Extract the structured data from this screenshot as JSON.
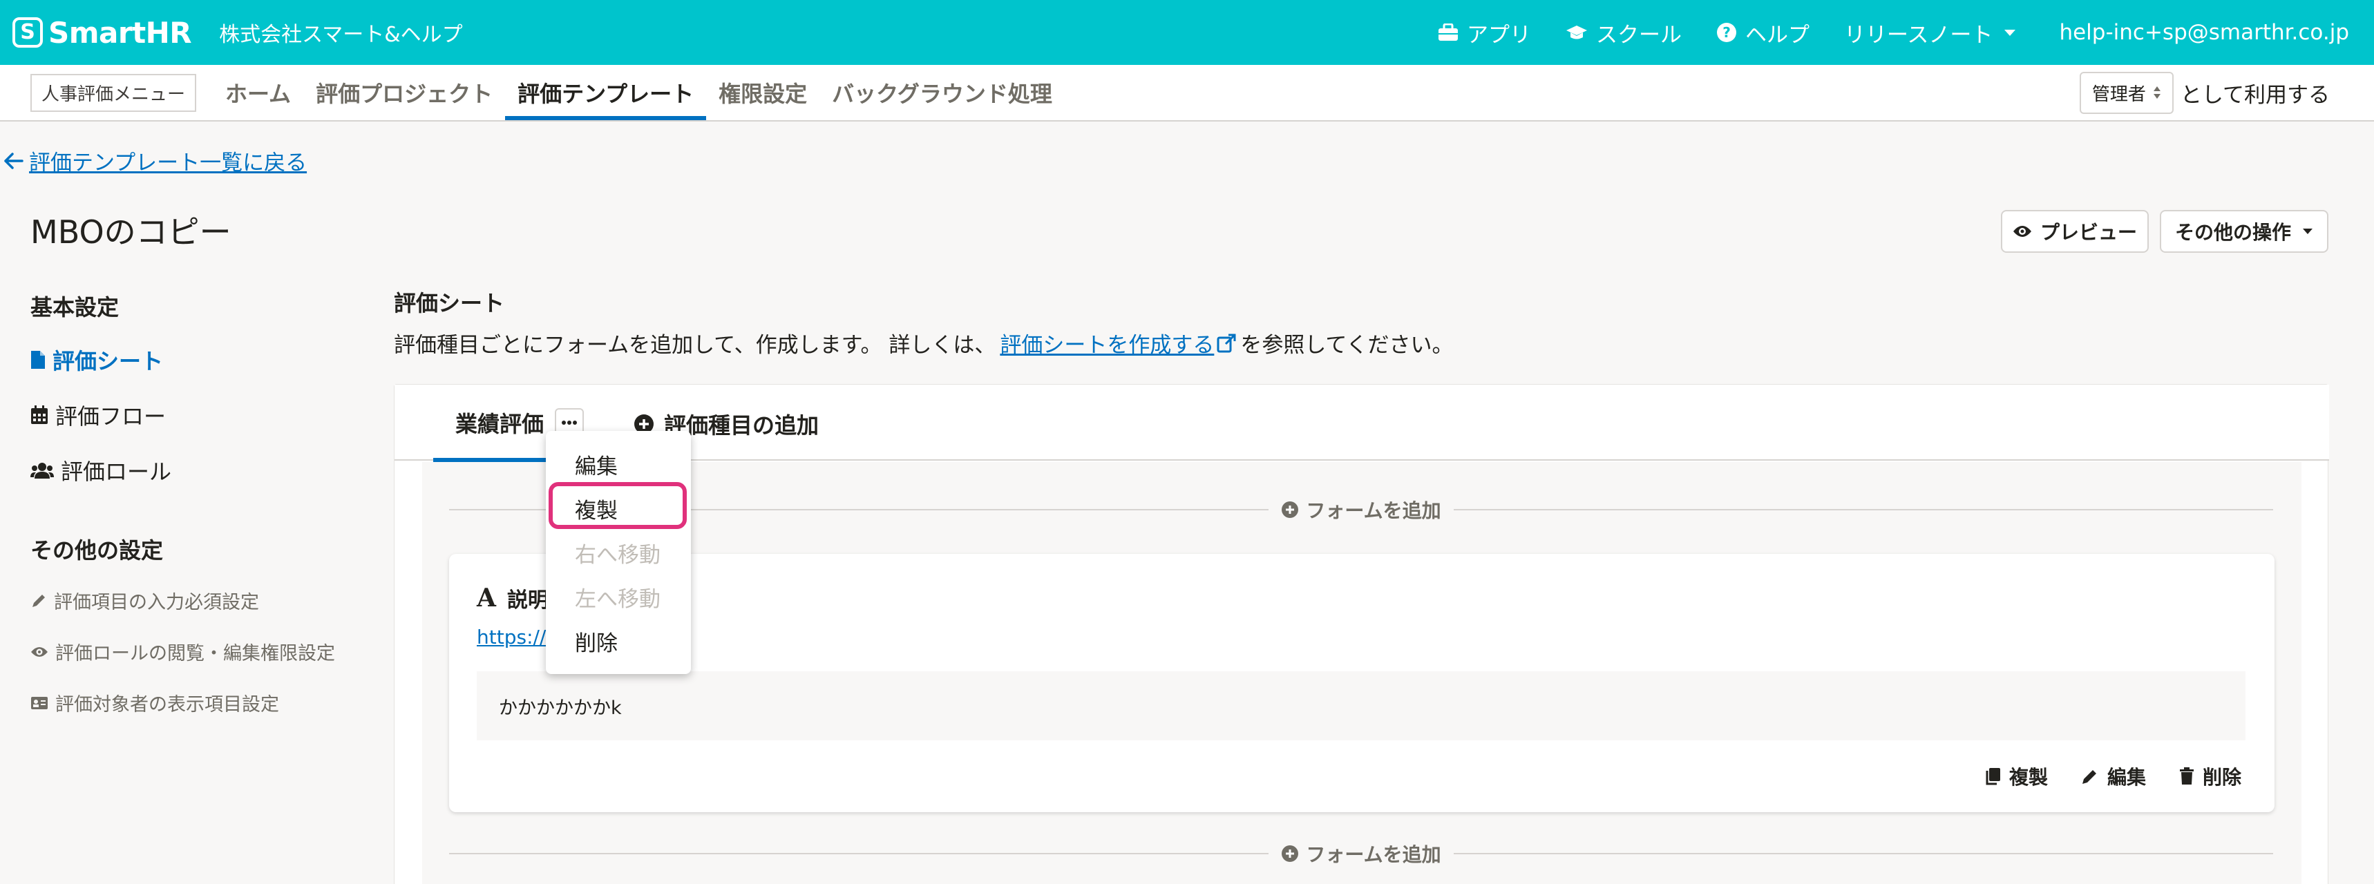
{
  "header": {
    "logo_text": "SmartHR",
    "logo_mark": "S",
    "company": "株式会社スマート&ヘルプ",
    "items": [
      {
        "label": "アプリ",
        "icon": "toolbox-icon"
      },
      {
        "label": "スクール",
        "icon": "graduation-cap-icon"
      },
      {
        "label": "ヘルプ",
        "icon": "question-circle-icon"
      },
      {
        "label": "リリースノート",
        "icon": "caret-down-icon"
      }
    ],
    "user_email": "help-inc+sp@smarthr.co.jp"
  },
  "nav": {
    "menu_label": "人事評価メニュー",
    "tabs": [
      {
        "label": "ホーム"
      },
      {
        "label": "評価プロジェクト"
      },
      {
        "label": "評価テンプレート"
      },
      {
        "label": "権限設定"
      },
      {
        "label": "バックグラウンド処理"
      }
    ],
    "active_tab": "評価テンプレート",
    "role_value": "管理者",
    "role_suffix": "として利用する"
  },
  "back_link": "評価テンプレート一覧に戻る",
  "page_title": "MBOのコピー",
  "actions": {
    "preview": "プレビュー",
    "other": "その他の操作"
  },
  "sidebar": {
    "basic_heading": "基本設定",
    "basic_items": [
      {
        "label": "評価シート",
        "icon": "file-icon"
      },
      {
        "label": "評価フロー",
        "icon": "calendar-icon"
      },
      {
        "label": "評価ロール",
        "icon": "users-icon"
      }
    ],
    "other_heading": "その他の設定",
    "other_items": [
      {
        "label": "評価項目の入力必須設定",
        "icon": "pencil-icon"
      },
      {
        "label": "評価ロールの閲覧・編集権限設定",
        "icon": "eye-icon"
      },
      {
        "label": "評価対象者の表示項目設定",
        "icon": "id-card-icon"
      }
    ]
  },
  "main": {
    "section_title": "評価シート",
    "desc_before": "評価種目ごとにフォームを追加して、作成します。 詳しくは、",
    "desc_link": "評価シートを作成する",
    "desc_after": "を参照してください。",
    "eval_tab": "業績評価",
    "add_type": "評価種目の追加",
    "add_form": "フォームを追加",
    "form": {
      "title": "説明",
      "url": "https://s",
      "text": "かかかかかかk",
      "actions": [
        "複製",
        "編集",
        "削除"
      ]
    }
  },
  "dropdown": {
    "items": [
      {
        "label": "編集",
        "disabled": false
      },
      {
        "label": "複製",
        "disabled": false
      },
      {
        "label": "右へ移動",
        "disabled": true
      },
      {
        "label": "左へ移動",
        "disabled": true
      },
      {
        "label": "削除",
        "disabled": false
      }
    ],
    "highlighted": "複製"
  },
  "colors": {
    "brand": "#00c4cc",
    "link": "#0071c1",
    "highlight": "#e0317c"
  }
}
